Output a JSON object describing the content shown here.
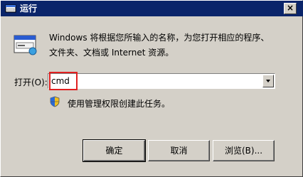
{
  "window": {
    "title": "运行",
    "close_label": "×"
  },
  "content": {
    "description_line1": "Windows 将根据您所输入的名称，为您打开相应的程序、",
    "description_line2": "文件夹、文档或 Internet 资源。",
    "open_label": "打开(O):",
    "command_value": "cmd",
    "admin_note": "使用管理权限创建此任务。"
  },
  "buttons": {
    "ok": "确定",
    "cancel": "取消",
    "browse": "浏览(B)..."
  },
  "icons": {
    "title": "run-icon",
    "app": "run-app-icon",
    "admin": "uac-shield-icon"
  },
  "colors": {
    "titlebar": "#0a246a",
    "highlight": "#e02020",
    "dialog_bg": "#d4d0c8"
  }
}
